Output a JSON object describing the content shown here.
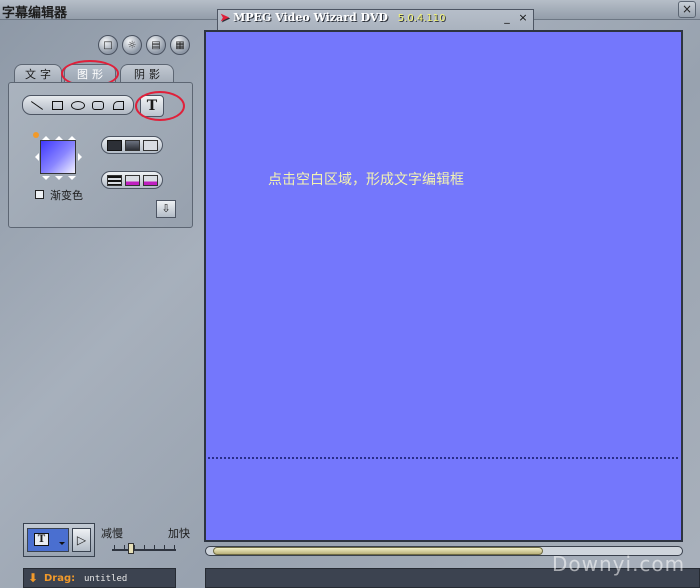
{
  "app": {
    "title": "字幕编辑器",
    "close_glyph": "×"
  },
  "tabs": [
    {
      "label": "文字",
      "active": false
    },
    {
      "label": "图形",
      "active": true
    },
    {
      "label": "阴影",
      "active": false
    }
  ],
  "shape_tools": [
    "line-icon",
    "rectangle-icon",
    "ellipse-icon",
    "rounded-rect-icon",
    "polygon-icon"
  ],
  "text_tool_glyph": "T",
  "fill": {
    "gradient_label": "渐变色",
    "gradient_checked": false,
    "swatch_colors": [
      "#3f38ff",
      "#8a86ff",
      "#f2f2ff"
    ]
  },
  "down_glyph": "⇩",
  "wizard": {
    "title": "MPEG Video Wizard DVD",
    "version": "5.0.4.110",
    "minimize_glyph": "_",
    "close_glyph": "×",
    "buttons": [
      "clip-icon",
      "film-icon",
      "photo-icon",
      "audio-icon",
      "subtitle-icon",
      "edit-text-icon",
      "transition-icon",
      "effect-icon",
      "layout-icon",
      "tag-icon",
      "export-icon"
    ]
  },
  "canvas": {
    "hint_text": "点击空白区域，形成文字编辑框",
    "background": "#7477fc"
  },
  "playback": {
    "mode_glyph": "T",
    "play_glyph": "▷",
    "slow_label": "减慢",
    "fast_label": "加快",
    "speed_level": 0.3
  },
  "status": {
    "arrow_glyph": "⬇",
    "drag_label": "Drag:",
    "file_name": "untitled"
  },
  "watermark": "Downyi.com",
  "annotation_color": "#e0203a"
}
